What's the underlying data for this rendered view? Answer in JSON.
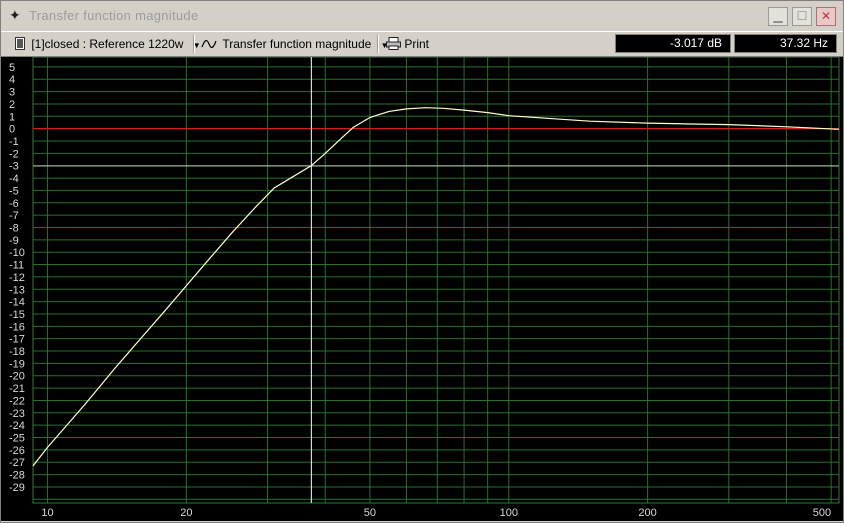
{
  "window": {
    "title": "Transfer function magnitude",
    "title_icon": "crosshair-icon"
  },
  "toolbar": {
    "measurement_icon": "document-icon",
    "measurement_label": "[1]closed : Reference 1220w",
    "graph_icon": "waveform-icon",
    "graph_label": "Transfer function magnitude",
    "print_icon": "printer-icon",
    "print_label": "Print",
    "readout_db": "-3.017 dB",
    "readout_hz": "37.32 Hz"
  },
  "colors": {
    "background": "#000000",
    "grid": "#2e7d32",
    "curve": "#ffffc8",
    "reference_line": "#d02020",
    "cursor": "#ffffff",
    "tick_text": "#d8d8d8"
  },
  "chart_data": {
    "type": "line",
    "x_scale": "log",
    "x_range": [
      9.3,
      520
    ],
    "y_range": [
      -30.3,
      5.8
    ],
    "x_tick_labels": [
      10,
      20,
      50,
      100,
      200,
      500
    ],
    "y_tick_labels": [
      5,
      4,
      3,
      2,
      1,
      0,
      -1,
      -2,
      -3,
      -4,
      -5,
      -6,
      -7,
      -8,
      -9,
      -10,
      -11,
      -12,
      -13,
      -14,
      -15,
      -16,
      -17,
      -18,
      -19,
      -20,
      -21,
      -22,
      -23,
      -24,
      -25,
      -26,
      -27,
      -28,
      -29
    ],
    "grid": true,
    "reference_level_db": 0,
    "cursor": {
      "x_hz": 37.32,
      "y_db": -3.017
    },
    "series": [
      {
        "x": [
          9.3,
          10,
          12,
          14,
          16,
          18,
          20,
          22,
          25,
          28,
          31,
          34,
          37.32,
          40,
          43,
          46,
          50,
          55,
          60,
          66,
          72,
          80,
          90,
          100,
          120,
          150,
          200,
          250,
          300,
          400,
          520
        ],
        "y": [
          -27.3,
          -25.8,
          -22.4,
          -19.4,
          -16.9,
          -14.7,
          -12.7,
          -10.9,
          -8.5,
          -6.5,
          -4.8,
          -3.9,
          -3.0,
          -2.0,
          -0.9,
          0.1,
          0.9,
          1.4,
          1.6,
          1.7,
          1.65,
          1.5,
          1.3,
          1.05,
          0.85,
          0.6,
          0.45,
          0.38,
          0.33,
          0.15,
          -0.05
        ]
      }
    ]
  }
}
